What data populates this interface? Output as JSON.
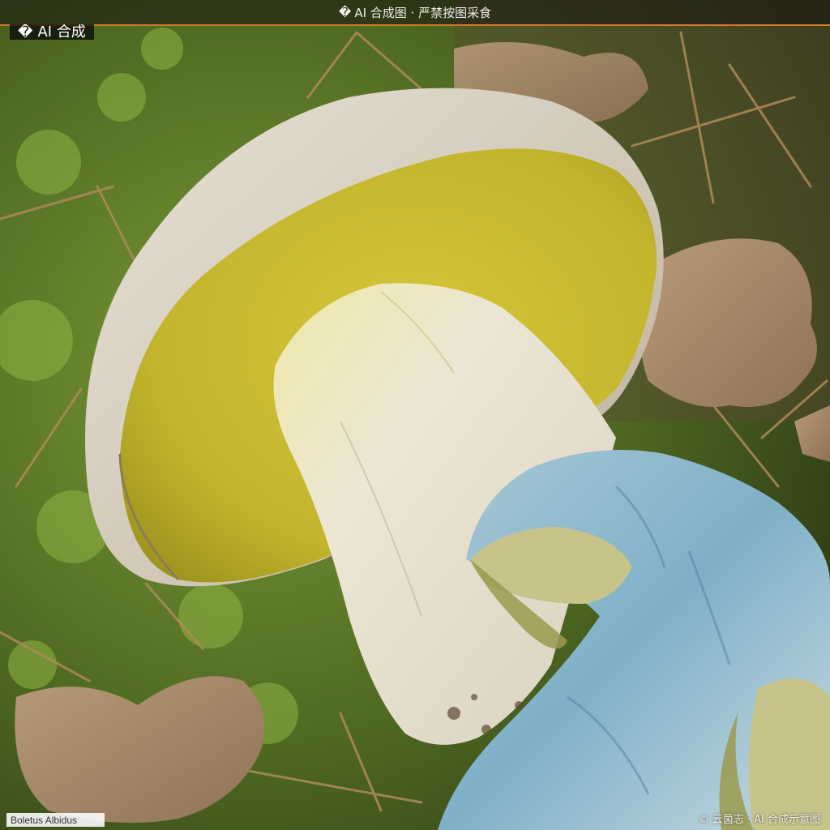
{
  "banner": {
    "icon": "info-glyph",
    "text": "AI 合成图 · 严禁按图采食",
    "accent_color": "#d9762a"
  },
  "badge": {
    "icon": "info-glyph",
    "text": "AI 合成"
  },
  "photo": {
    "species_label": "Boletus Albidus"
  },
  "credit": {
    "text": "© 云菌志 · AI 合成示意图"
  }
}
